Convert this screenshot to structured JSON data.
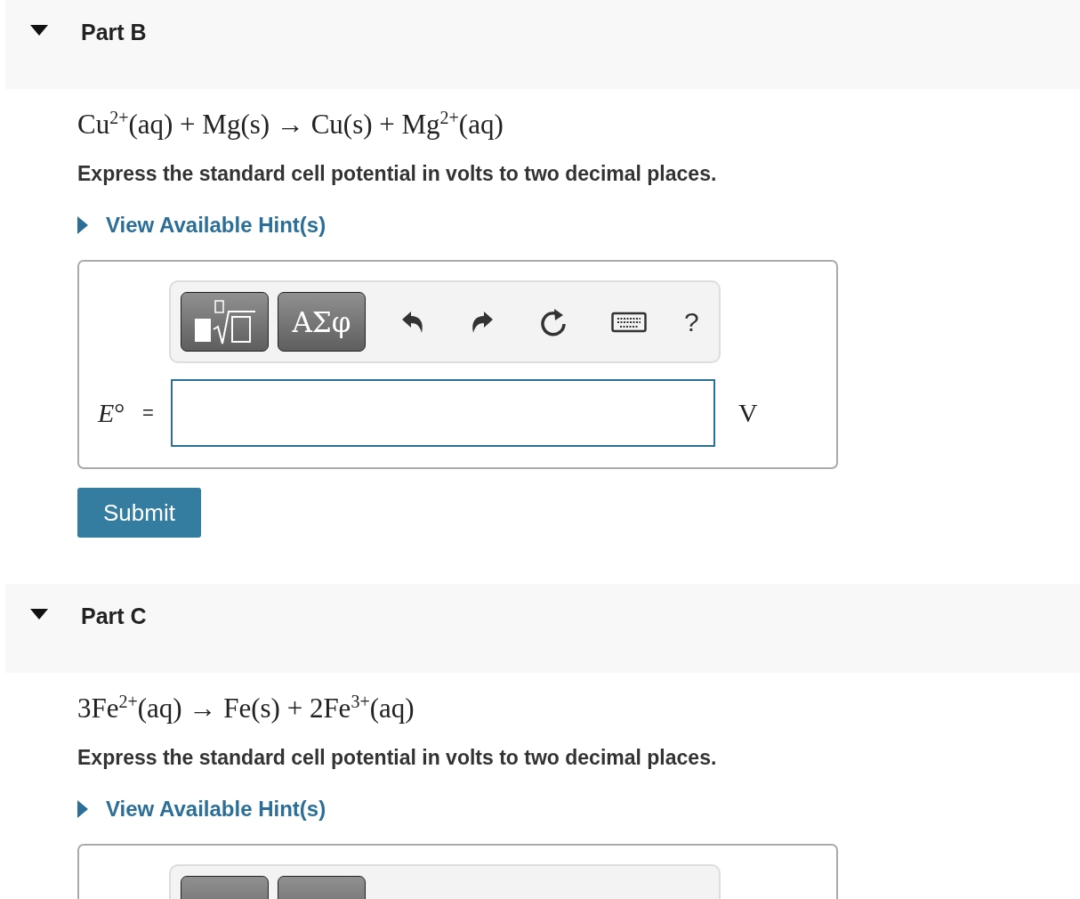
{
  "parts": [
    {
      "title": "Part B",
      "expanded": true,
      "equation": "Cu$^{2+}$(aq) + Mg(s) → Cu(s) + Mg$^{2+}$(aq)",
      "instruction": "Express the standard cell potential in volts to two decimal places.",
      "hint": {
        "label": "View Available Hint(s)",
        "expanded": false
      },
      "answer": {
        "kind": "full",
        "symbols": "ΑΣφ",
        "help": "?",
        "label": "*E*°",
        "equals": "=",
        "unit": "V"
      },
      "submit": "Submit"
    },
    {
      "title": "Part C",
      "expanded": true,
      "equation": "3Fe$^{2+}$(aq) → Fe(s) + 2Fe$^{3+}$(aq)",
      "instruction": "Express the standard cell potential in volts to two decimal places.",
      "hint": {
        "label": "View Available Hint(s)",
        "expanded": false
      },
      "answer": {
        "kind": "cut"
      }
    }
  ]
}
